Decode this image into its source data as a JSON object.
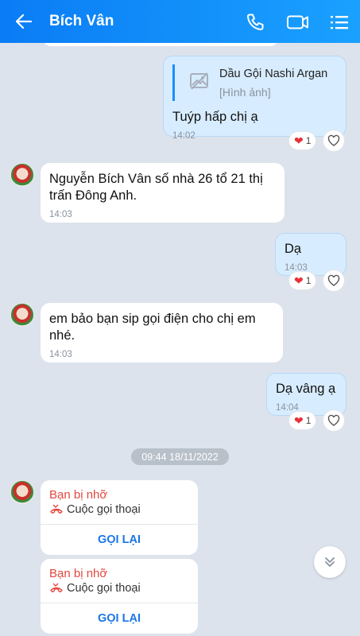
{
  "header": {
    "title": "Bích Vân"
  },
  "colors": {
    "header_start": "#0a7cf5",
    "header_end": "#1aa1ff",
    "outgoing_bubble": "#d7ecfe",
    "missed_call": "#e2483f",
    "call_back": "#1a76e6"
  },
  "icons": {
    "back": "arrow-left-icon",
    "call": "phone-icon",
    "video": "video-camera-icon",
    "menu": "list-menu-icon"
  },
  "messages": [
    {
      "from": "me",
      "quote_title": "Dầu Gội Nashi Argan",
      "quote_sub": "[Hình ảnh]",
      "text": "Tuýp hấp chị ạ",
      "time": "14:02",
      "reaction_count": "1"
    },
    {
      "from": "Bích Vân",
      "text": "Nguyễn Bích Vân số nhà 26 tổ 21 thị trấn Đông Anh.",
      "time": "14:03"
    },
    {
      "from": "me",
      "text": "Dạ",
      "time": "14:03",
      "reaction_count": "1"
    },
    {
      "from": "Bích Vân",
      "text": "em bảo bạn sip gọi điện cho chị em nhé.",
      "time": "14:03"
    },
    {
      "from": "me",
      "text": "Dạ vâng ạ",
      "time": "14:04",
      "reaction_count": "1"
    }
  ],
  "date_separator": "09:44 18/11/2022",
  "missed_calls": [
    {
      "title": "Bạn bị nhỡ",
      "subtitle": "Cuộc gọi thoại",
      "action": "GỌI LẠI"
    },
    {
      "title": "Bạn bị nhỡ",
      "subtitle": "Cuộc gọi thoại",
      "action": "GỌI LẠI"
    }
  ]
}
